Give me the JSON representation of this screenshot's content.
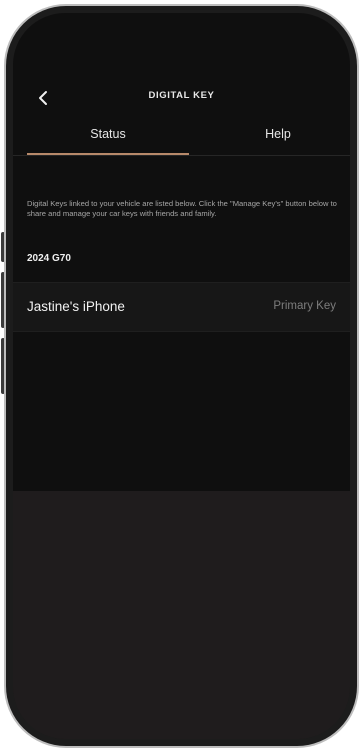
{
  "header": {
    "title": "DIGITAL KEY",
    "back_icon": "chevron-left-icon"
  },
  "tabs": [
    {
      "label": "Status",
      "active": true
    },
    {
      "label": "Help",
      "active": false
    }
  ],
  "status": {
    "info_text": "Digital Keys linked to your vehicle are listed below. Click the \"Manage Key's\" button below to share and manage your car keys with friends and family.",
    "vehicle": "2024 G70",
    "keys": [
      {
        "device": "Jastine's iPhone",
        "type": "Primary Key"
      }
    ]
  },
  "colors": {
    "background": "#0f0f0f",
    "accent": "#b7896a",
    "text": "#f0f0f0",
    "muted": "#7d7d7d"
  }
}
